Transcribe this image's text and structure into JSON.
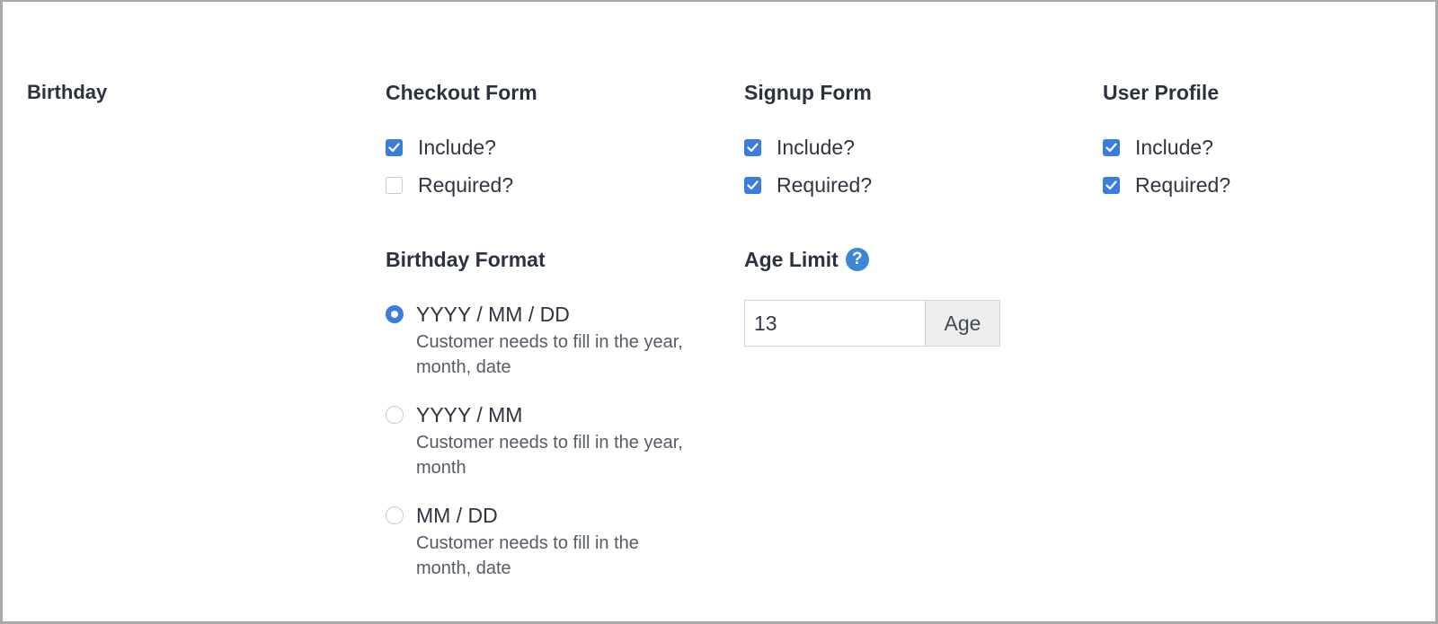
{
  "section": {
    "title": "Birthday"
  },
  "forms": [
    {
      "title": "Checkout Form",
      "include_label": "Include?",
      "include_checked": true,
      "required_label": "Required?",
      "required_checked": false
    },
    {
      "title": "Signup Form",
      "include_label": "Include?",
      "include_checked": true,
      "required_label": "Required?",
      "required_checked": true
    },
    {
      "title": "User Profile",
      "include_label": "Include?",
      "include_checked": true,
      "required_label": "Required?",
      "required_checked": true
    }
  ],
  "birthday_format": {
    "title": "Birthday Format",
    "options": [
      {
        "label": "YYYY / MM / DD",
        "description": "Customer needs to fill in the year, month, date",
        "selected": true
      },
      {
        "label": "YYYY / MM",
        "description": "Customer needs to fill in the year, month",
        "selected": false
      },
      {
        "label": "MM / DD",
        "description": "Customer needs to fill in the month, date",
        "selected": false
      }
    ]
  },
  "age_limit": {
    "title": "Age Limit",
    "help_icon": "question-circle-icon",
    "value": "13",
    "addon": "Age"
  },
  "colors": {
    "accent": "#3b7ddd",
    "help_icon": "#3b88d8",
    "text": "#2c3340"
  }
}
